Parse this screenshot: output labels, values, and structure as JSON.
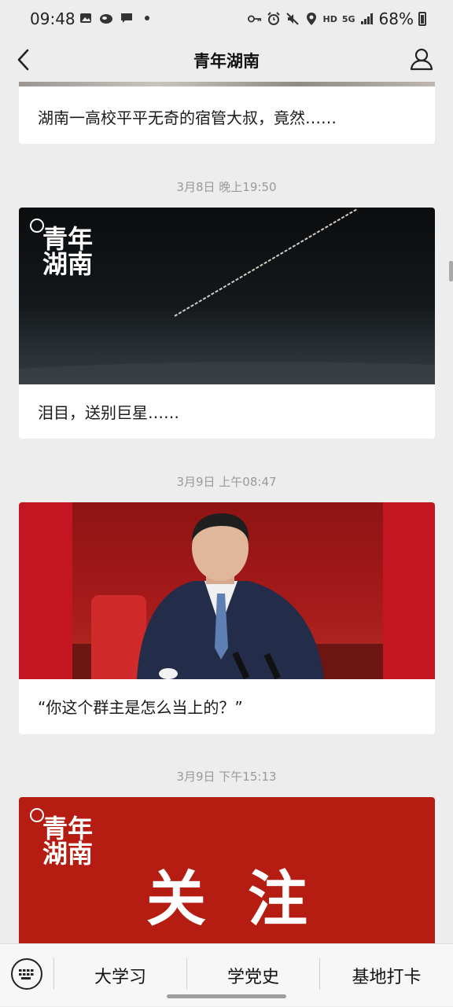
{
  "status_bar": {
    "time": "09:48",
    "network": "5G",
    "hd": "HD",
    "battery": "68%"
  },
  "header": {
    "title": "青年湖南"
  },
  "feed": {
    "articles": [
      {
        "title": "湖南一高校平平无奇的宿管大叔，竟然……"
      },
      {
        "timestamp": "3月8日 晚上19:50",
        "title": "泪目，送别巨星……",
        "logo_top": "青年",
        "logo_bottom": "湖南"
      },
      {
        "timestamp": "3月9日 上午08:47",
        "title": "“你这个群主是怎么当上的？”"
      },
      {
        "timestamp": "3月9日 下午15:13",
        "logo_top": "青年",
        "logo_bottom": "湖南",
        "banner_text": "关  注"
      }
    ]
  },
  "bottom_menu": {
    "items": [
      {
        "label": "大学习"
      },
      {
        "label": "学党史"
      },
      {
        "label": "基地打卡"
      }
    ]
  }
}
